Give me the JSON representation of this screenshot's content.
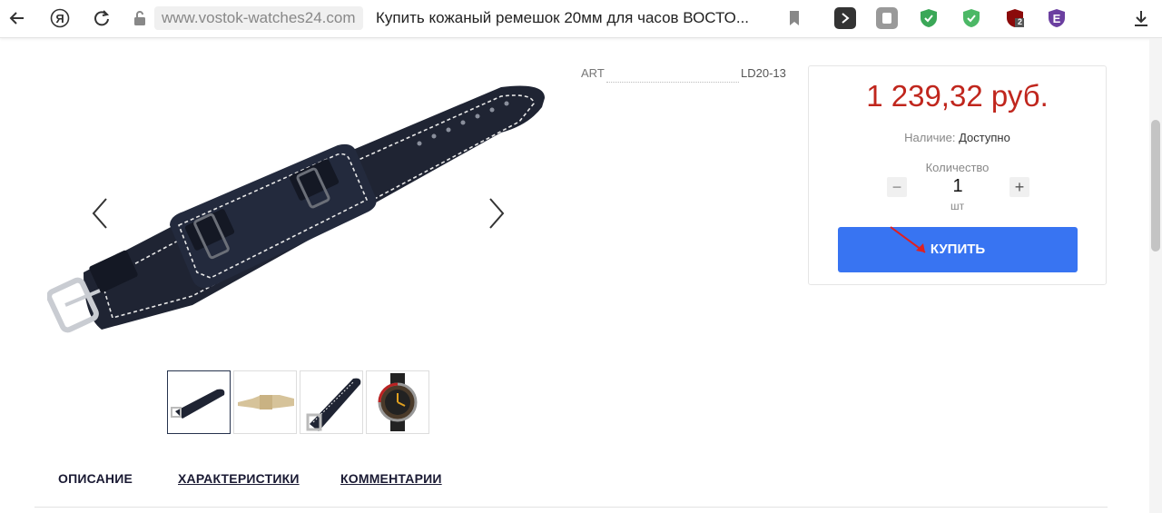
{
  "browser": {
    "url": "www.vostok-watches24.com",
    "page_title": "Купить кожаный ремешок 20мм для часов ВОСТО...",
    "yandex_glyph": "Я",
    "extensions": [
      {
        "name": "extension-generic-icon",
        "color": "#777777"
      },
      {
        "name": "extension-shield-green-icon",
        "color": "#3aa757"
      },
      {
        "name": "extension-shield-green-icon",
        "color": "#3aa757"
      },
      {
        "name": "extension-ublock-icon",
        "color": "#8b0a0a",
        "badge": "2"
      },
      {
        "name": "extension-e-icon",
        "color": "#6b3fa0",
        "glyph": "E"
      }
    ]
  },
  "product": {
    "art_label": "ART",
    "art_value": "LD20-13",
    "price": "1 239,32 руб.",
    "availability_label": "Наличие:",
    "availability_value": "Доступно",
    "quantity_label": "Количество",
    "quantity_value": "1",
    "quantity_unit": "шт",
    "minus": "−",
    "plus": "+",
    "buy_label": "КУПИТЬ"
  },
  "tabs": [
    {
      "label": "ОПИСАНИЕ"
    },
    {
      "label": "ХАРАКТЕРИСТИКИ"
    },
    {
      "label": "КОММЕНТАРИИ"
    }
  ],
  "colors": {
    "price": "#c0261d",
    "buy_button": "#3874f2",
    "strap": "#1f2433",
    "stitch": "#e8e8e8"
  }
}
